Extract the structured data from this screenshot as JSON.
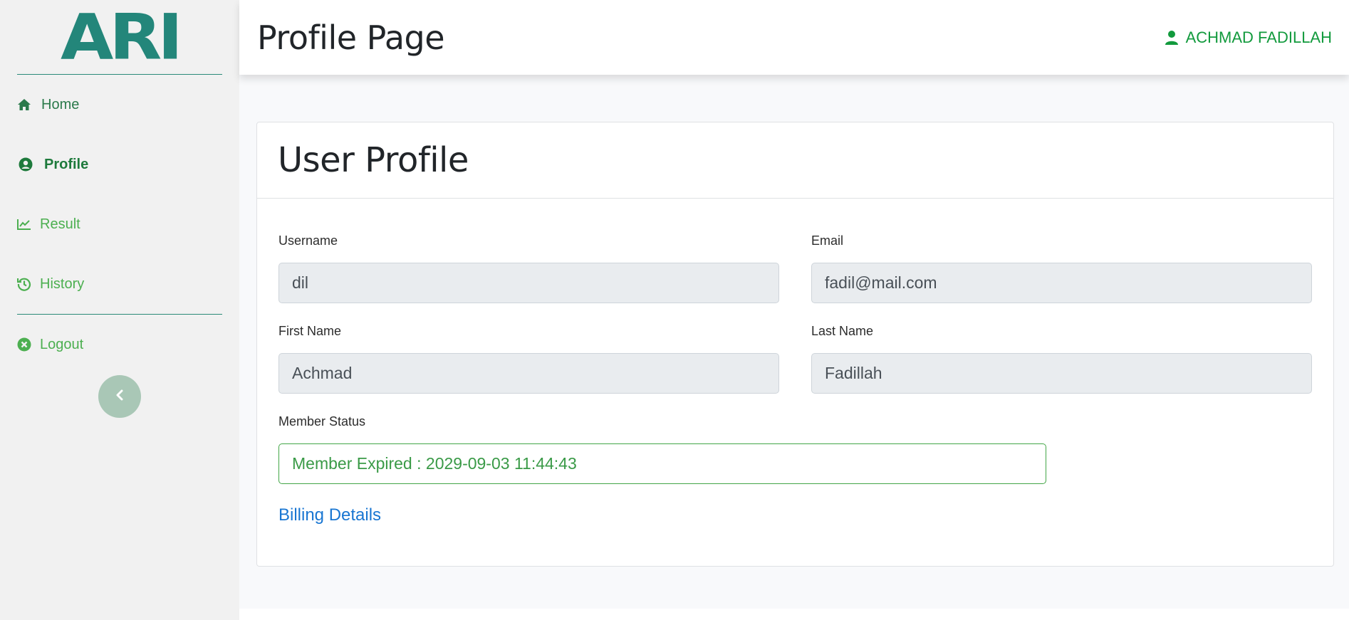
{
  "sidebar": {
    "logo_text": "ARI",
    "items": [
      {
        "label": "Home",
        "icon": "home-icon"
      },
      {
        "label": "Profile",
        "icon": "user-circle-icon"
      },
      {
        "label": "Result",
        "icon": "chart-line-icon"
      },
      {
        "label": "History",
        "icon": "history-icon"
      },
      {
        "label": "Logout",
        "icon": "times-circle-icon"
      }
    ],
    "collapse_icon": "chevron-left-icon"
  },
  "header": {
    "title": "Profile Page",
    "user_name": "ACHMAD FADILLAH",
    "user_icon": "user-icon"
  },
  "card": {
    "title": "User Profile",
    "fields": {
      "username": {
        "label": "Username",
        "value": "dil"
      },
      "email": {
        "label": "Email",
        "value": "fadil@mail.com"
      },
      "first_name": {
        "label": "First Name",
        "value": "Achmad"
      },
      "last_name": {
        "label": "Last Name",
        "value": "Fadillah"
      },
      "member_status": {
        "label": "Member Status",
        "value": "Member Expired : 2029-09-03 11:44:43"
      }
    },
    "billing_link": "Billing Details"
  },
  "colors": {
    "brand": "#23867a",
    "accent_green": "#129a3d",
    "link_blue": "#1976d2",
    "status_green": "#43a647"
  }
}
